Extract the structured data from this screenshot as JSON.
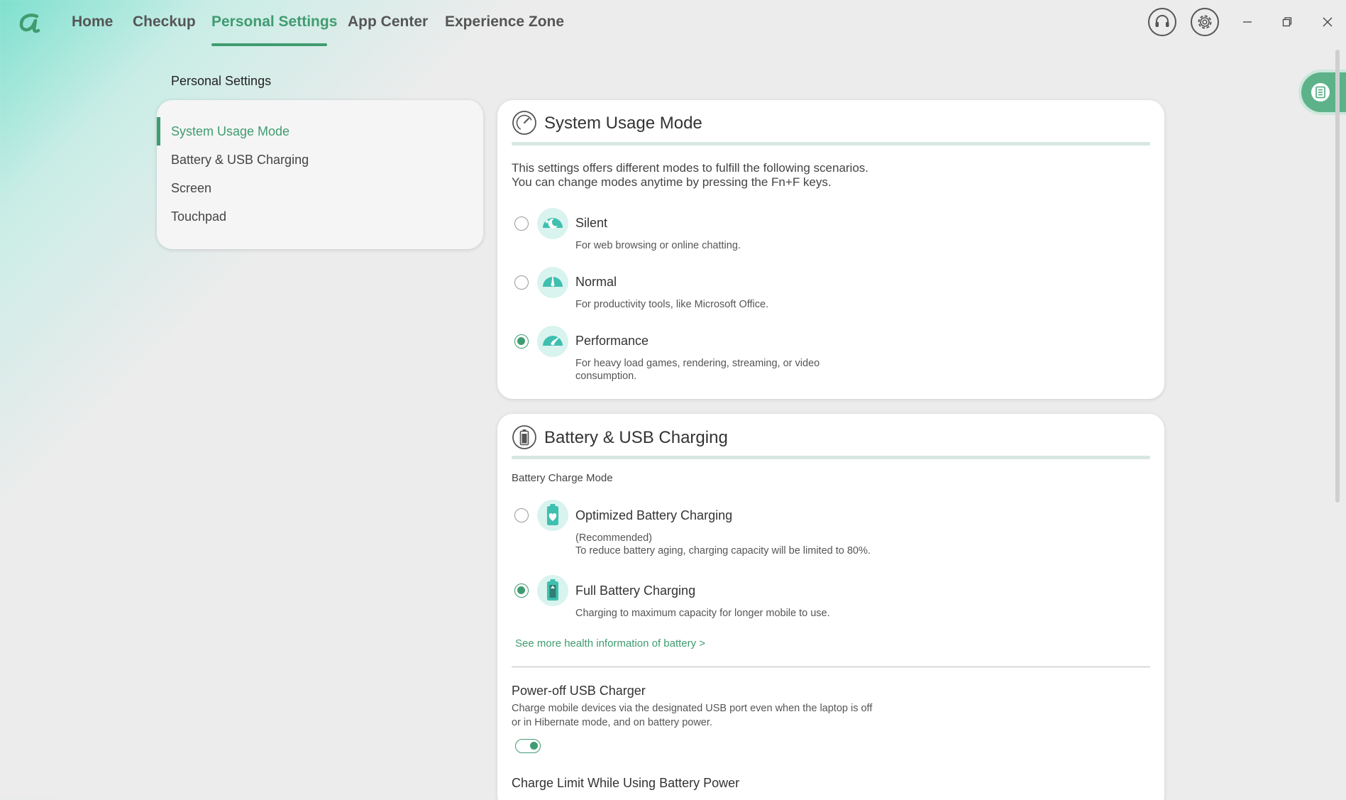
{
  "nav": {
    "tabs": [
      {
        "label": "Home"
      },
      {
        "label": "Checkup"
      },
      {
        "label": "Personal Settings"
      },
      {
        "label": "App Center"
      },
      {
        "label": "Experience Zone"
      }
    ],
    "active_tab": "Personal Settings"
  },
  "page": {
    "heading": "Personal Settings"
  },
  "sidebar": {
    "items": [
      {
        "label": "System Usage Mode"
      },
      {
        "label": "Battery & USB Charging"
      },
      {
        "label": "Screen"
      },
      {
        "label": "Touchpad"
      }
    ],
    "active_item": "System Usage Mode"
  },
  "usage_mode": {
    "title": "System Usage Mode",
    "desc_line1": "This settings offers different modes to fulfill the following scenarios.",
    "desc_line2": "You can change modes anytime by pressing the Fn+F keys.",
    "options": [
      {
        "label": "Silent",
        "sub1": "For web browsing or online chatting.",
        "sub2": "",
        "selected": false
      },
      {
        "label": "Normal",
        "sub1": "For productivity tools, like Microsoft Office.",
        "sub2": "",
        "selected": false
      },
      {
        "label": "Performance",
        "sub1": "For heavy load games, rendering, streaming, or video",
        "sub2": "consumption.",
        "selected": true
      }
    ]
  },
  "battery": {
    "title": "Battery & USB Charging",
    "charge_mode_label": "Battery Charge Mode",
    "options": [
      {
        "label": "Optimized Battery Charging",
        "sub1": "(Recommended)",
        "sub2": "To reduce battery aging, charging capacity will be limited to 80%.",
        "selected": false
      },
      {
        "label": "Full Battery Charging",
        "sub1": "Charging to maximum capacity for longer mobile to use.",
        "sub2": "",
        "selected": true
      }
    ],
    "health_link": "See more health information of battery >",
    "usb_charger": {
      "title": "Power-off USB Charger",
      "desc_line1": "Charge mobile devices via the designated USB port even when the laptop is off",
      "desc_line2": "or in Hibernate mode, and on battery power.",
      "enabled": true
    },
    "charge_limit_title": "Charge Limit While Using Battery Power"
  },
  "colors": {
    "accent": "#3f9c70",
    "icon_bg": "#d9f3ee",
    "icon_fg": "#3fbfb0"
  },
  "icons": [
    "headset-icon",
    "gear-icon",
    "minimize-icon",
    "maximize-icon",
    "close-icon",
    "list-icon"
  ]
}
